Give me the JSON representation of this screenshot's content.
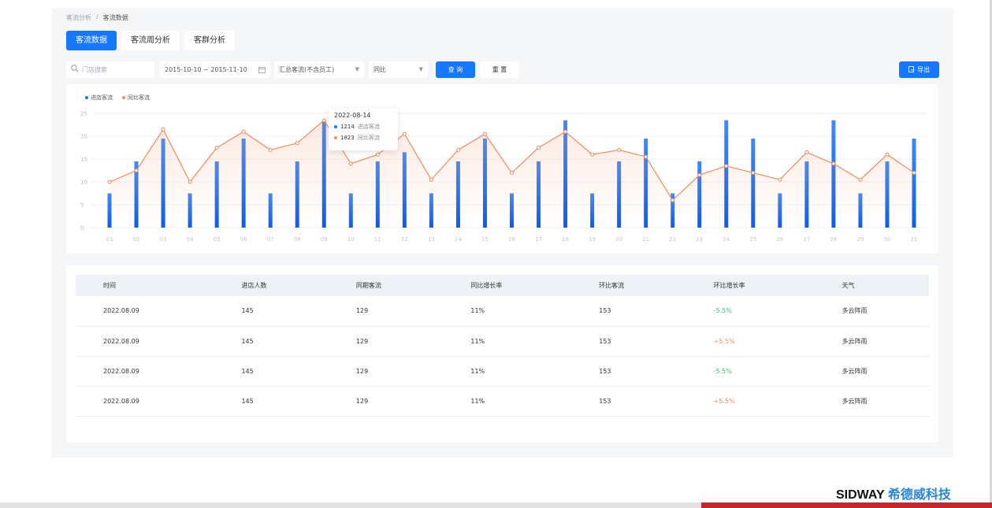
{
  "breadcrumb": {
    "parent": "客流分析",
    "current": "客流数据"
  },
  "tabs": [
    {
      "label": "客流数据",
      "active": true
    },
    {
      "label": "客流周分析",
      "active": false
    },
    {
      "label": "客群分析",
      "active": false
    }
  ],
  "toolbar": {
    "search_placeholder": "门店搜索",
    "date_range": "2015-10-10 ~ 2015-11-10",
    "flow_type": "汇总客流(不含员工)",
    "compare": "同比",
    "query_label": "查 询",
    "reset_label": "重 置",
    "export_label": "导出"
  },
  "colors": {
    "accent": "#1677ff",
    "line": "#f08a5d",
    "up": "#f08a5d",
    "down": "#2fc47a"
  },
  "chart_data": {
    "type": "bar",
    "categories": [
      "01",
      "02",
      "03",
      "04",
      "05",
      "06",
      "07",
      "08",
      "09",
      "10",
      "11",
      "12",
      "13",
      "14",
      "15",
      "16",
      "17",
      "18",
      "19",
      "20",
      "21",
      "22",
      "23",
      "24",
      "25",
      "26",
      "27",
      "28",
      "29",
      "30",
      "31"
    ],
    "series": [
      {
        "name": "进店客流",
        "type": "bar",
        "values": [
          7.5,
          14.5,
          19.5,
          7.5,
          14.5,
          19.5,
          7.5,
          14.5,
          23.5,
          7.5,
          14.5,
          16.5,
          7.5,
          14.5,
          19.5,
          7.5,
          14.5,
          23.5,
          7.5,
          14.5,
          19.5,
          7.5,
          14.5,
          23.5,
          19.5,
          7.5,
          14.5,
          23.5,
          7.5,
          14.5,
          19.5
        ]
      },
      {
        "name": "同比客流",
        "type": "line",
        "values": [
          10,
          12.5,
          21.5,
          10,
          17.5,
          21,
          17,
          18.5,
          23.5,
          14,
          16,
          20.5,
          10.5,
          17,
          20.5,
          12,
          17.5,
          21,
          16,
          17,
          15.5,
          6,
          11.5,
          13.5,
          12,
          10.5,
          16.5,
          14,
          10.5,
          16,
          12
        ]
      }
    ],
    "yticks": [
      0,
      5,
      10,
      15,
      20,
      25
    ],
    "ylim": [
      0,
      25
    ],
    "grid": true,
    "legend_position": "top-left",
    "tooltip": {
      "date": "2022-08-14",
      "rows": [
        {
          "value": "1214",
          "label": "进店客流"
        },
        {
          "value": "1823",
          "label": "同比客流"
        }
      ]
    }
  },
  "table": {
    "headers": [
      "时间",
      "进店人数",
      "同期客流",
      "同比增长率",
      "环比客流",
      "环比增长率",
      "天气"
    ],
    "rows": [
      {
        "date": "2022.08.09",
        "visitors": "145",
        "same_period": "129",
        "yoy": "11%",
        "mom_flow": "153",
        "mom_rate": "-5.5%",
        "trend": "down",
        "weather": "多云阵雨"
      },
      {
        "date": "2022.08.09",
        "visitors": "145",
        "same_period": "129",
        "yoy": "11%",
        "mom_flow": "153",
        "mom_rate": "+5.5%",
        "trend": "up",
        "weather": "多云阵雨"
      },
      {
        "date": "2022.08.09",
        "visitors": "145",
        "same_period": "129",
        "yoy": "11%",
        "mom_flow": "153",
        "mom_rate": "-5.5%",
        "trend": "down",
        "weather": "多云阵雨"
      },
      {
        "date": "2022.08.09",
        "visitors": "145",
        "same_period": "129",
        "yoy": "11%",
        "mom_flow": "153",
        "mom_rate": "+5.5%",
        "trend": "up",
        "weather": "多云阵雨"
      }
    ]
  },
  "brand": {
    "en": "SIDWAY",
    "cn": "希德威科技"
  }
}
